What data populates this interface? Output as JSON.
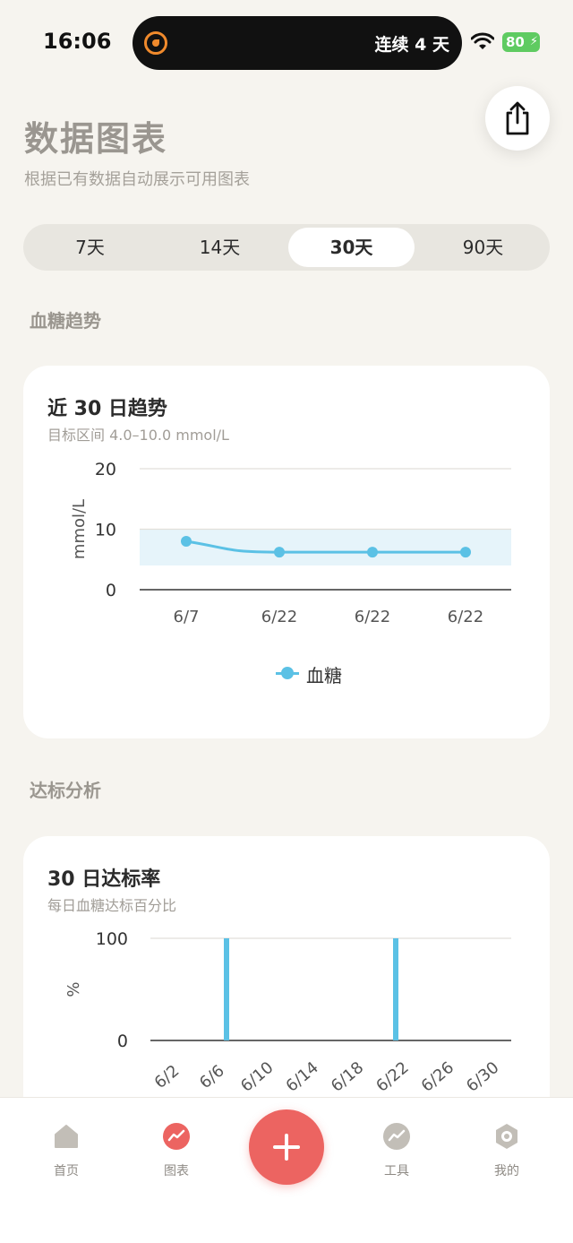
{
  "status_bar": {
    "time": "16:06",
    "streak": "连续 4 天",
    "battery": "80"
  },
  "header": {
    "title": "数据图表",
    "subtitle": "根据已有数据自动展示可用图表"
  },
  "range_tabs": [
    {
      "label": "7天",
      "active": false
    },
    {
      "label": "14天",
      "active": false
    },
    {
      "label": "30天",
      "active": true
    },
    {
      "label": "90天",
      "active": false
    }
  ],
  "sections": {
    "trend": "血糖趋势",
    "compliance": "达标分析"
  },
  "trend_card": {
    "title": "近 30 日趋势",
    "subtitle": "目标区间 4.0–10.0 mmol/L"
  },
  "compliance_card": {
    "title": "30 日达标率",
    "subtitle": "每日血糖达标百分比"
  },
  "tabbar": {
    "items": [
      {
        "label": "首页",
        "icon": "home-icon"
      },
      {
        "label": "图表",
        "icon": "chart-icon"
      },
      {
        "label": "工具",
        "icon": "tools-icon"
      },
      {
        "label": "我的",
        "icon": "profile-icon"
      }
    ],
    "add_icon": "plus-icon"
  },
  "colors": {
    "accent": "#ec6461",
    "series": "#5bc1e5",
    "target_band": "#e6f4fa"
  },
  "chart_data": [
    {
      "type": "line",
      "ylabel": "mmol/L",
      "ylim": [
        0,
        20
      ],
      "yticks": [
        0,
        10,
        20
      ],
      "target_range": [
        4.0,
        10.0
      ],
      "categories": [
        "6/7",
        "6/22",
        "6/22",
        "6/22"
      ],
      "series": [
        {
          "name": "血糖",
          "values": [
            8.0,
            6.2,
            6.2,
            6.2
          ]
        }
      ],
      "grid": true,
      "legend": "bottom"
    },
    {
      "type": "bar",
      "ylabel": "%",
      "ylim": [
        0,
        100
      ],
      "yticks": [
        0,
        100
      ],
      "x_ticks": [
        "6/2",
        "6/6",
        "6/10",
        "6/14",
        "6/18",
        "6/22",
        "6/26",
        "6/30"
      ],
      "dates": [
        "6/7",
        "6/22"
      ],
      "values": [
        100,
        100
      ],
      "grid": true
    }
  ]
}
